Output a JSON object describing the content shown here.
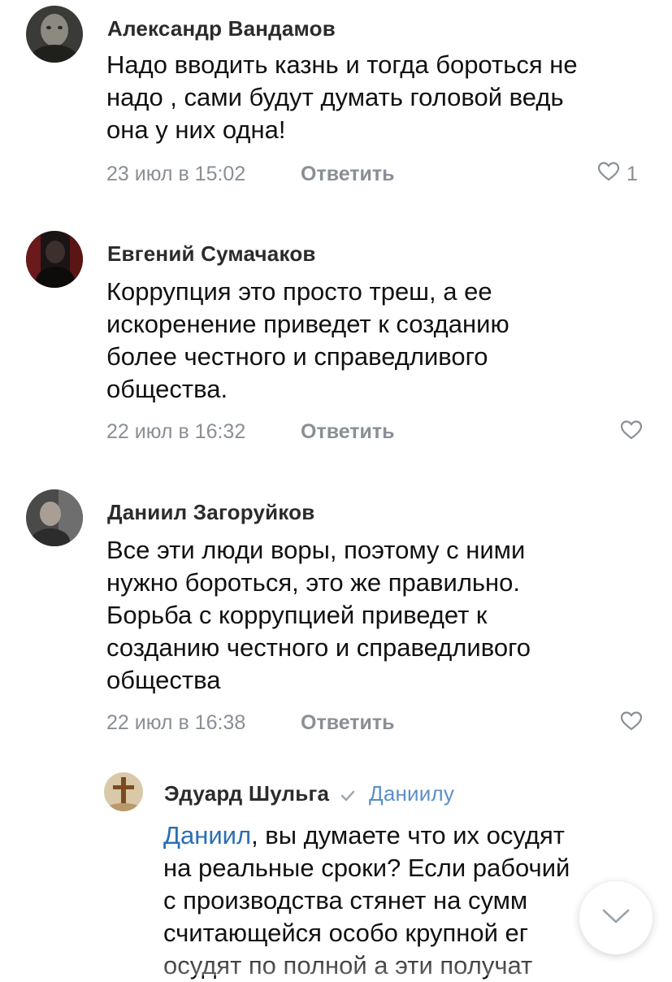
{
  "comments": [
    {
      "author": "Александр Вандамов",
      "lines": [
        "Надо вводить казнь и тогда бороться не",
        "надо , сами будут думать головой  ведь",
        "она у них одна!"
      ],
      "date": "23 июл в 15:02",
      "reply_label": "Ответить",
      "like_icon": "heart-outline-icon",
      "likes": "1"
    },
    {
      "author": "Евгений Сумачаков",
      "lines": [
        "Коррупция это просто треш, а ее",
        "искоренение приведет к созданию",
        "более честного и справедливого",
        "общества."
      ],
      "date": "22 июл в 16:32",
      "reply_label": "Ответить",
      "like_icon": "heart-outline-icon"
    },
    {
      "author": "Даниил Загоруйков",
      "lines": [
        "Все эти люди воры, поэтому с ними",
        "нужно бороться, это же правильно.",
        "Борьба с коррупцией приведет к",
        "созданию честного и справедливого",
        "общества"
      ],
      "date": "22 июл в 16:38",
      "reply_label": "Ответить",
      "like_icon": "heart-outline-icon"
    }
  ],
  "reply": {
    "author": "Эдуард Шульга",
    "reply_to": "Даниилу",
    "mention": "Даниил",
    "first_line_rest": ", вы думаете что их осудят",
    "lines": [
      "на реальные сроки? Если рабочий",
      "с производства стянет на сумм",
      "считающейся особо крупной ег",
      "осудят по полной а эти получат"
    ]
  },
  "colors": {
    "meta": "#8a8f96",
    "mention": "#2a6fb5",
    "reply_to": "#5b8fc7"
  },
  "scroll_button_icon": "chevron-down-icon"
}
